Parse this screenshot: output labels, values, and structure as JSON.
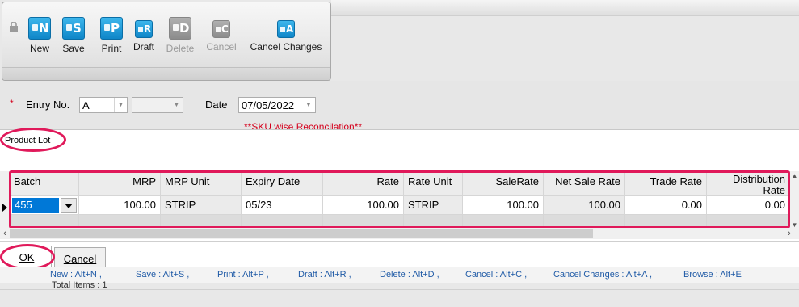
{
  "toolbar": {
    "buttons": [
      {
        "label": "New",
        "letter": "N",
        "icon": "new-doc-icon",
        "enabled": true
      },
      {
        "label": "Save",
        "letter": "S",
        "icon": "save-doc-icon",
        "enabled": true
      },
      {
        "label": "Print",
        "letter": "P",
        "icon": "print-doc-icon",
        "enabled": true
      },
      {
        "label": "Draft",
        "letter": "R",
        "icon": "draft-doc-icon",
        "enabled": true
      },
      {
        "label": "Delete",
        "letter": "D",
        "icon": "delete-doc-icon",
        "enabled": false
      },
      {
        "label": "Cancel",
        "letter": "C",
        "icon": "cancel-doc-icon",
        "enabled": false
      },
      {
        "label": "Cancel Changes",
        "letter": "A",
        "icon": "cancel-changes-icon",
        "enabled": true
      }
    ]
  },
  "form": {
    "required_marker": "*",
    "entry_no_label": "Entry No.",
    "entry_prefix": "A",
    "entry_number": "",
    "date_label": "Date",
    "date_value": "07/05/2022",
    "section_title": "**SKU wise Reconcilation**"
  },
  "lot": {
    "title": "Product Lot",
    "columns": [
      "Batch",
      "MRP",
      "MRP Unit",
      "Expiry Date",
      "Rate",
      "Rate Unit",
      "SaleRate",
      "Net Sale Rate",
      "Trade Rate",
      "Distribution Rate"
    ],
    "row": {
      "batch": "455",
      "mrp": "100.00",
      "mrp_unit": "STRIP",
      "expiry": "05/23",
      "rate": "100.00",
      "rate_unit": "STRIP",
      "sale_rate": "100.00",
      "net_sale_rate": "100.00",
      "trade_rate": "0.00",
      "distribution_rate": "0.00"
    }
  },
  "tabs": {
    "ok": "OK",
    "cancel": "Cancel"
  },
  "shortcuts": [
    "New : Alt+N ,",
    "Save : Alt+S ,",
    "Print : Alt+P ,",
    "Draft : Alt+R ,",
    "Delete : Alt+D ,",
    "Cancel : Alt+C ,",
    "Cancel Changes : Alt+A ,",
    "Browse : Alt+E"
  ],
  "footer": {
    "total_items": "Total Items : 1"
  },
  "colors": {
    "highlight": "#e0195a",
    "selection": "#0078d7",
    "required": "#d4001c",
    "shortcut_text": "#1f5aa6"
  }
}
